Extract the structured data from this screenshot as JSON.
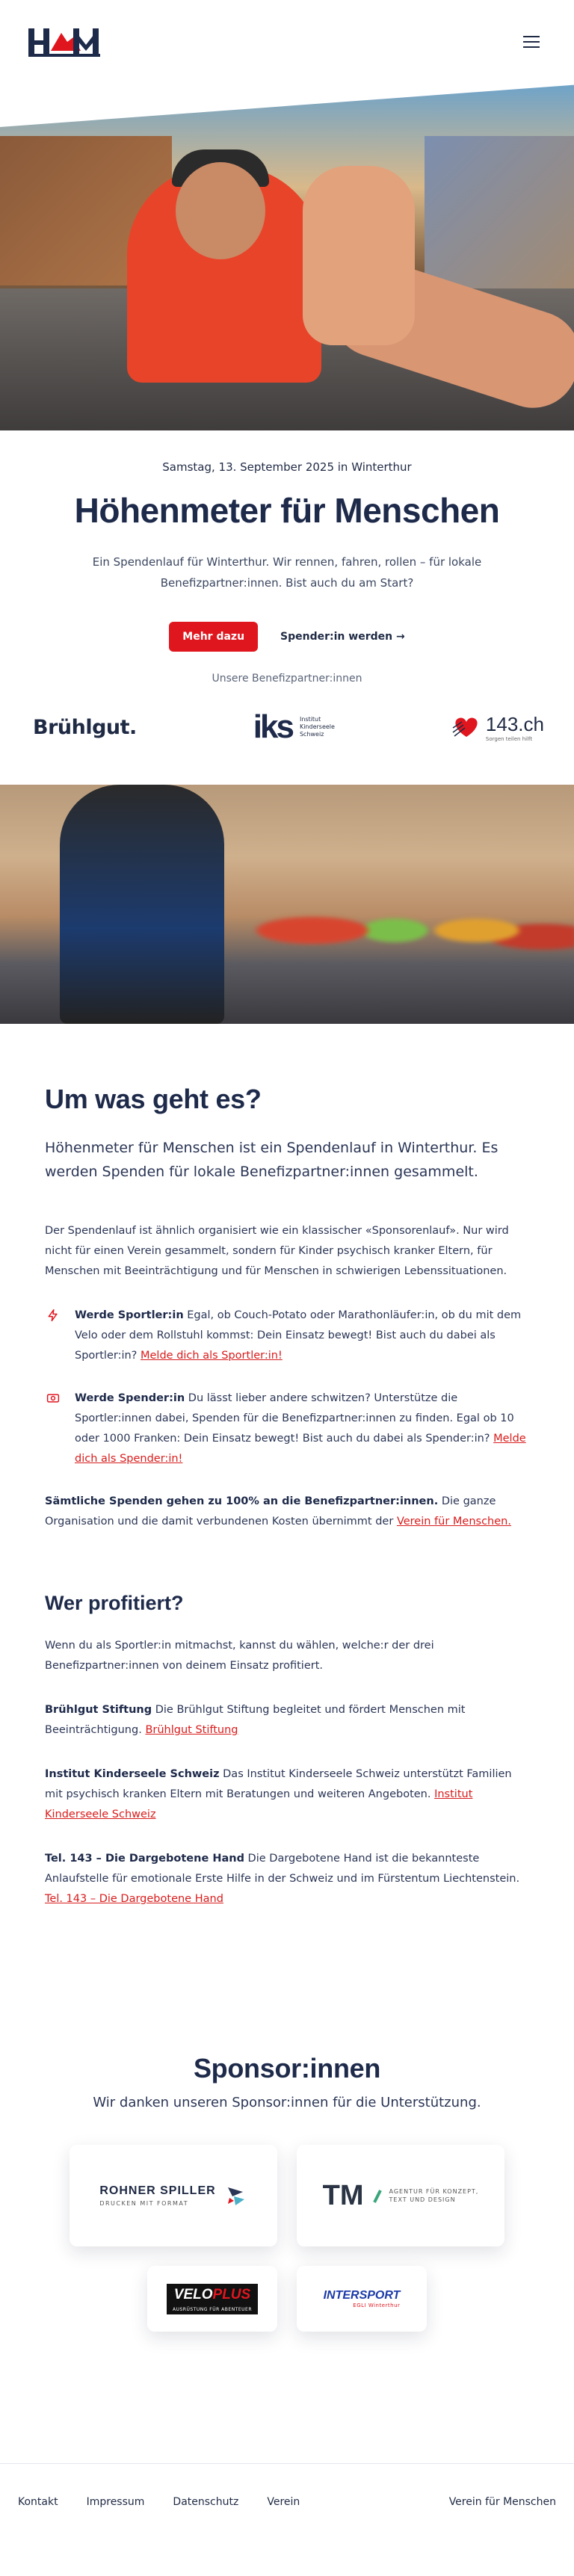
{
  "header": {
    "logo_alt": "H&M Höhenmeter für Menschen",
    "menu_icon": "hamburger-menu-icon"
  },
  "hero": {
    "date": "Samstag, 13. September 2025 in Winterthur",
    "title": "Höhenmeter für Menschen",
    "lead": "Ein Spendenlauf für Winterthur. Wir rennen, fahren, rollen – für lokale Benefizpartner:innen. Bist auch du am Start?",
    "cta_primary": "Mehr dazu",
    "cta_secondary": "Spender:in werden →",
    "partners_label": "Unsere Benefizpartner:innen",
    "partner_logos": {
      "bruehlgut": "Brühlgut.",
      "iks_mark": "iks",
      "iks_text": [
        "Institut",
        "Kinderseele",
        "Schweiz"
      ],
      "tel143": "143.ch",
      "tel143_sub": "Sorgen teilen hilft"
    }
  },
  "about": {
    "title": "Um was geht es?",
    "intro": "Höhenmeter für Menschen ist ein Spendenlauf in Winterthur. Es werden Spenden für lokale Benefizpartner:innen gesammelt.",
    "text": "Der Spendenlauf ist ähnlich organisiert wie ein klassischer «Sponsorenlauf». Nur wird nicht für einen Verein gesammelt, sondern für Kinder psychisch kranker Eltern, für Menschen mit Beeinträchtigung und für Menschen in schwierigen Lebenssituationen.",
    "features": [
      {
        "icon": "lightning-icon",
        "title": "Werde Sportler:in",
        "text": " Egal, ob Couch-Potato oder Marathonläufer:in, ob du mit dem Velo oder dem Rollstuhl kommst: Dein Einsatz bewegt! Bist auch du dabei als Sportler:in? ",
        "link": "Melde dich als Sportler:in!"
      },
      {
        "icon": "money-icon",
        "title": "Werde Spender:in",
        "text": " Du lässt lieber andere schwitzen? Unterstütze die Sportler:innen dabei, Spenden für die Benefizpartner:innen zu finden. Egal ob 10 oder 1000 Franken: Dein Einsatz bewegt! Bist auch du dabei als Spender:in? ",
        "link": "Melde dich als Spender:in!"
      }
    ],
    "donation_bold": "Sämtliche Spenden gehen zu 100% an die Benefizpartner:innen.",
    "donation_text": " Die ganze Organisation und die damit verbundenen Kosten übernimmt der ",
    "donation_link": "Verein für Menschen."
  },
  "beneficiaries": {
    "title": "Wer profitiert?",
    "intro": "Wenn du als Sportler:in mitmachst, kannst du wählen, welche:r der drei Benefizpartner:innen von deinem Einsatz profitiert.",
    "items": [
      {
        "name": "Brühlgut Stiftung",
        "text": " Die Brühlgut Stiftung begleitet und fördert Menschen mit Beeinträchtigung. ",
        "link": "Brühlgut Stiftung"
      },
      {
        "name": "Institut Kinderseele Schweiz",
        "text": " Das Institut Kinderseele Schweiz unterstützt Familien mit psychisch kranken Eltern mit Beratungen und weiteren Angeboten. ",
        "link": "Institut Kinderseele Schweiz"
      },
      {
        "name": "Tel. 143 – Die Dargebotene Hand",
        "text": " Die Dargebotene Hand ist die bekannteste Anlaufstelle für emotionale Erste Hilfe in der Schweiz und im Fürstentum Liechtenstein. ",
        "link": "Tel. 143 – Die Dargebotene Hand"
      }
    ]
  },
  "sponsors": {
    "title": "Sponsor:innen",
    "lead": "Wir danken unseren Sponsor:innen für die Unterstützung.",
    "rohner_name": "ROHNER SPILLER",
    "rohner_sub": "DRUCKEN MIT FORMAT",
    "tm_mark": "TM",
    "tm_text": [
      "AGENTUR FÜR KONZEPT,",
      "TEXT UND DESIGN"
    ],
    "velo_a": "VELO",
    "velo_b": "PLUS",
    "velo_sub": "AUSRÜSTUNG FÜR ABENTEUER",
    "intersport": "INTERSPORT",
    "intersport_sub": "EGLI Winterthur"
  },
  "footer": {
    "links": [
      "Kontakt",
      "Impressum",
      "Datenschutz",
      "Verein"
    ],
    "right": "Verein für Menschen"
  },
  "colors": {
    "accent": "#e0161f",
    "navy": "#1e2a4a"
  }
}
